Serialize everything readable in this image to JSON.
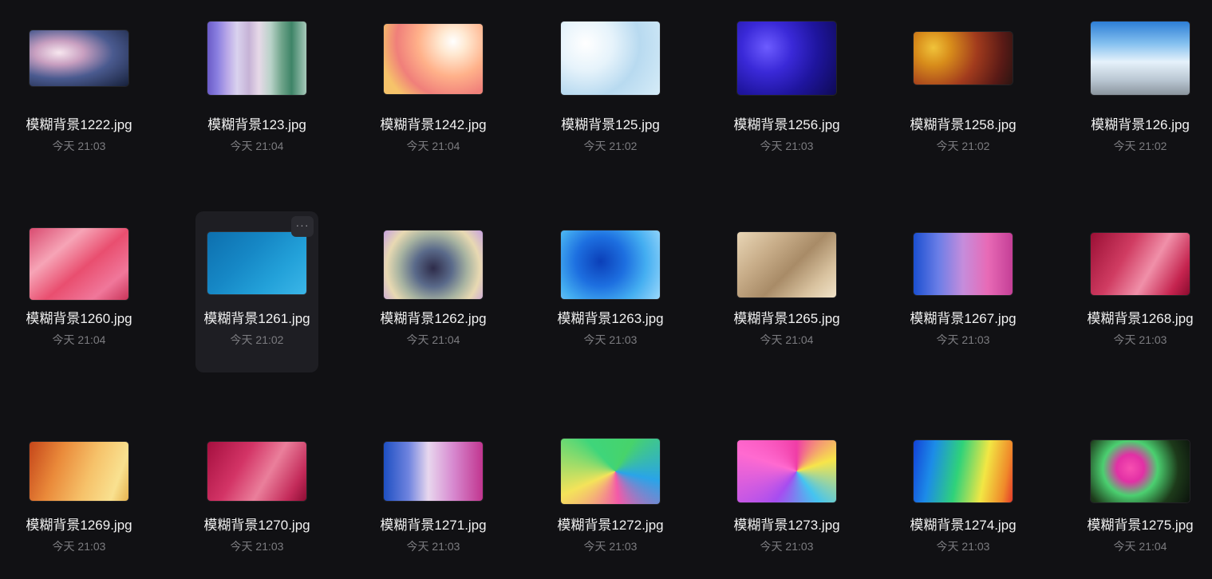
{
  "files": [
    {
      "name": "模糊背景1222.jpg",
      "time": "今天 21:03",
      "thumb": "radial-gradient(ellipse at 30% 40%, #f7e7ef 0%, #c89fc0 25%, #4a5a8f 55%, #16203a 100%)"
    },
    {
      "name": "模糊背景123.jpg",
      "time": "今天 21:04",
      "thumb": "linear-gradient(90deg, #6a5bc7 0%, #8a7fe0 10%, #b9a8e8 20%, #d9d2ee 30%, #c6b3d6 42%, #e7d9e8 52%, #b8d2c8 64%, #6fa48a 75%, #3e8467 85%, #a7c9ba 100%)"
    },
    {
      "name": "模糊背景1242.jpg",
      "time": "今天 21:04",
      "thumb": "radial-gradient(circle at 70% 25%, #ffffff 0%, #ffe9d2 15%, #ffb18a 40%, #f07f7a 65%, #f6c36a 85%), linear-gradient(#fff,#fff)"
    },
    {
      "name": "模糊背景125.jpg",
      "time": "今天 21:02",
      "thumb": "radial-gradient(circle at 25% 30%, #ffffff 0%, #e6f3fb 30%, #b8daf0 60%, #d6ecf8 100%)"
    },
    {
      "name": "模糊背景1256.jpg",
      "time": "今天 21:03",
      "thumb": "radial-gradient(circle at 30% 35%, #6d5cff 0%, #3a29d8 30%, #1f159f 60%, #0e0a54 100%)"
    },
    {
      "name": "模糊背景1258.jpg",
      "time": "今天 21:02",
      "thumb": "radial-gradient(circle at 20% 30%, #f0c33a 0%, #d88d1b 20%, #a23b1d 50%, #5a1a16 80%, #2b1512 100%)"
    },
    {
      "name": "模糊背景126.jpg",
      "time": "今天 21:02",
      "thumb": "linear-gradient(180deg, #2d7ed6 0%, #84c0ef 30%, #e6f2fb 55%, #b9c6d2 80%, #8a949d 100%)"
    },
    {
      "name": "模糊背景1260.jpg",
      "time": "今天 21:04",
      "thumb": "linear-gradient(140deg, #d94b70 0%, #f6a4b6 30%, #e94e6f 55%, #f0779a 80%, #c93459 100%)"
    },
    {
      "name": "模糊背景1261.jpg",
      "time": "今天 21:02",
      "thumb": "linear-gradient(135deg, #0d6fae 0%, #1688c6 40%, #23a1d9 70%, #3bb6e8 100%)",
      "hover": true
    },
    {
      "name": "模糊背景1262.jpg",
      "time": "今天 21:04",
      "thumb": "radial-gradient(circle at 50% 55%, #2e2c4a 0%, #5a6a8a 30%, #a7b3a1 55%, #e8d9b2 75%, #c7a1e0 100%)"
    },
    {
      "name": "模糊背景1263.jpg",
      "time": "今天 21:03",
      "thumb": "radial-gradient(circle at 40% 45%, #0b3fb8 0%, #1d6fe0 35%, #44aef1 65%, #9bd8fb 100%)"
    },
    {
      "name": "模糊背景1265.jpg",
      "time": "今天 21:04",
      "thumb": "linear-gradient(135deg, #e9d6b6 0%, #c8ad89 30%, #a88b67 55%, #d9c3a0 80%, #f1e3c9 100%)"
    },
    {
      "name": "模糊背景1267.jpg",
      "time": "今天 21:03",
      "thumb": "linear-gradient(90deg, #1b4fd0 0%, #6b7ee7 25%, #c58ddc 50%, #e86ab6 75%, #c43f96 100%)"
    },
    {
      "name": "模糊背景1268.jpg",
      "time": "今天 21:03",
      "thumb": "linear-gradient(120deg, #9a0f35 0%, #d03c62 35%, #f090a9 60%, #c5244f 85%, #8a0b2e 100%)"
    },
    {
      "name": "模糊背景1269.jpg",
      "time": "今天 21:03",
      "thumb": "linear-gradient(110deg, #c5461a 0%, #ea8a3a 30%, #f6c26a 60%, #f9e190 85%, #e6b34f 100%)"
    },
    {
      "name": "模糊背景1270.jpg",
      "time": "今天 21:03",
      "thumb": "linear-gradient(120deg, #a50f3f 0%, #d33466 35%, #ea7f9b 60%, #c42b5a 85%, #8d0d34 100%)"
    },
    {
      "name": "模糊背景1271.jpg",
      "time": "今天 21:03",
      "thumb": "linear-gradient(90deg, #1e4fc2 0%, #6f84df 25%, #e8d7ee 45%, #d78ad0 70%, #c1358f 100%)"
    },
    {
      "name": "模糊背景1272.jpg",
      "time": "今天 21:03",
      "thumb": "conic-gradient(from 30deg at 55% 50%, #47d36b, #2aa4e8, #f35aa8, #f4e35a, #3fd57a, #47d36b)"
    },
    {
      "name": "模糊背景1273.jpg",
      "time": "今天 21:03",
      "thumb": "conic-gradient(from 0deg at 60% 50%, #f03da6, #f7e54a, #45c4f0, #a64df0, #ff6ad0, #f03da6)"
    },
    {
      "name": "模糊背景1274.jpg",
      "time": "今天 21:03",
      "thumb": "linear-gradient(100deg, #1342d8 0%, #1c8ce8 20%, #2fd27a 45%, #f2e744 70%, #f08a2a 90%, #e43a2a 100%)"
    },
    {
      "name": "模糊背景1275.jpg",
      "time": "今天 21:04",
      "thumb": "radial-gradient(circle at 40% 45%, #f74fb1 0%, #e230a5 20%, #4bd070 40%, #1d3a1a 70%, #0b120c 100%)"
    }
  ],
  "more_button": "···"
}
